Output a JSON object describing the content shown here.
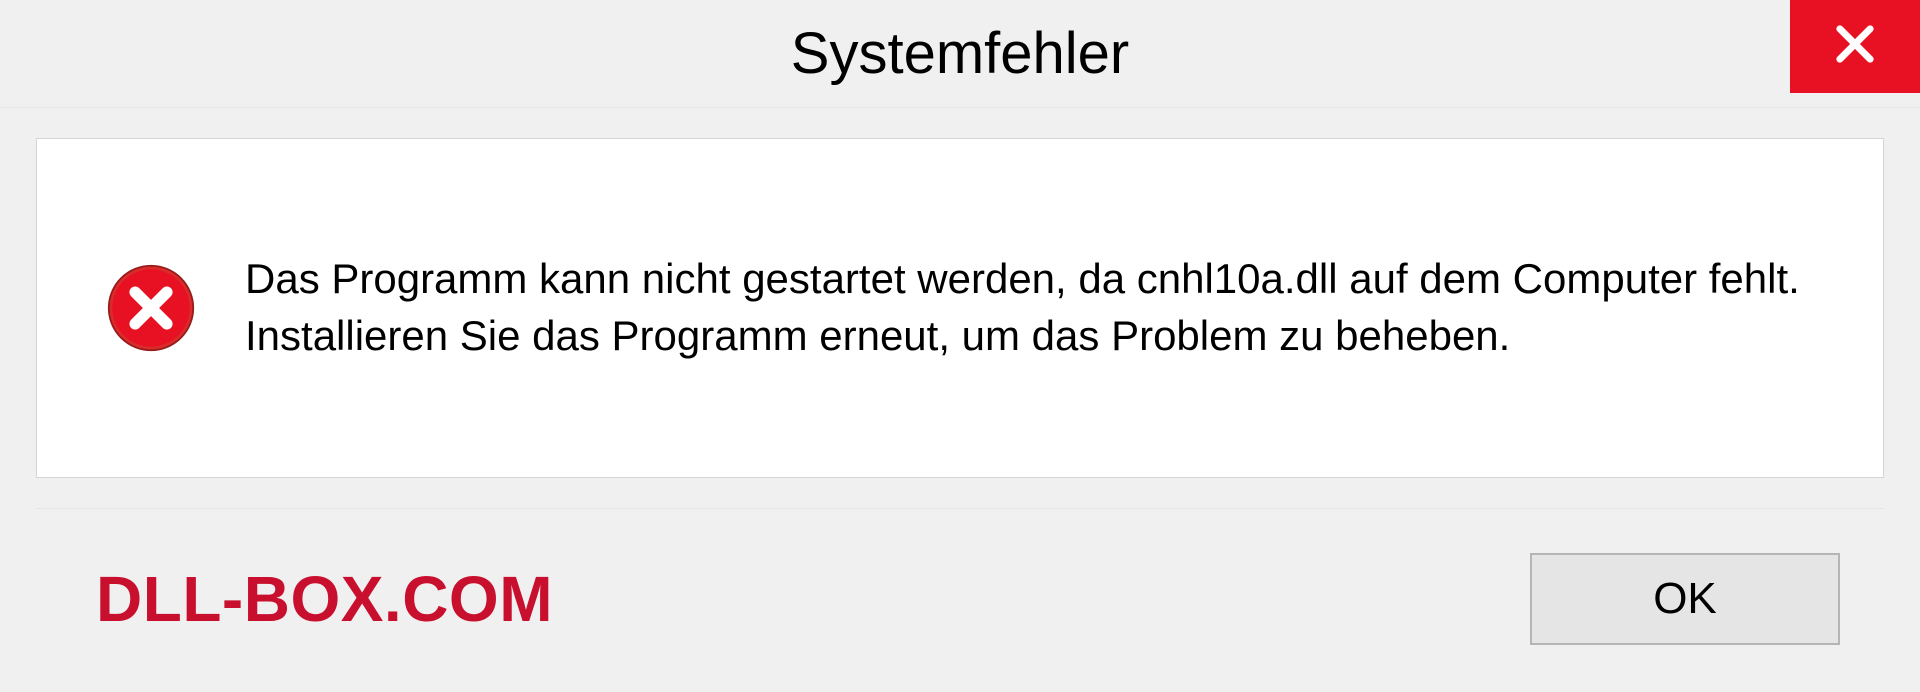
{
  "dialog": {
    "title": "Systemfehler",
    "message": "Das Programm kann nicht gestartet werden, da cnhl10a.dll auf dem Computer fehlt. Installieren Sie das Programm erneut, um das Problem zu beheben.",
    "ok_label": "OK"
  },
  "watermark": "DLL-BOX.COM"
}
